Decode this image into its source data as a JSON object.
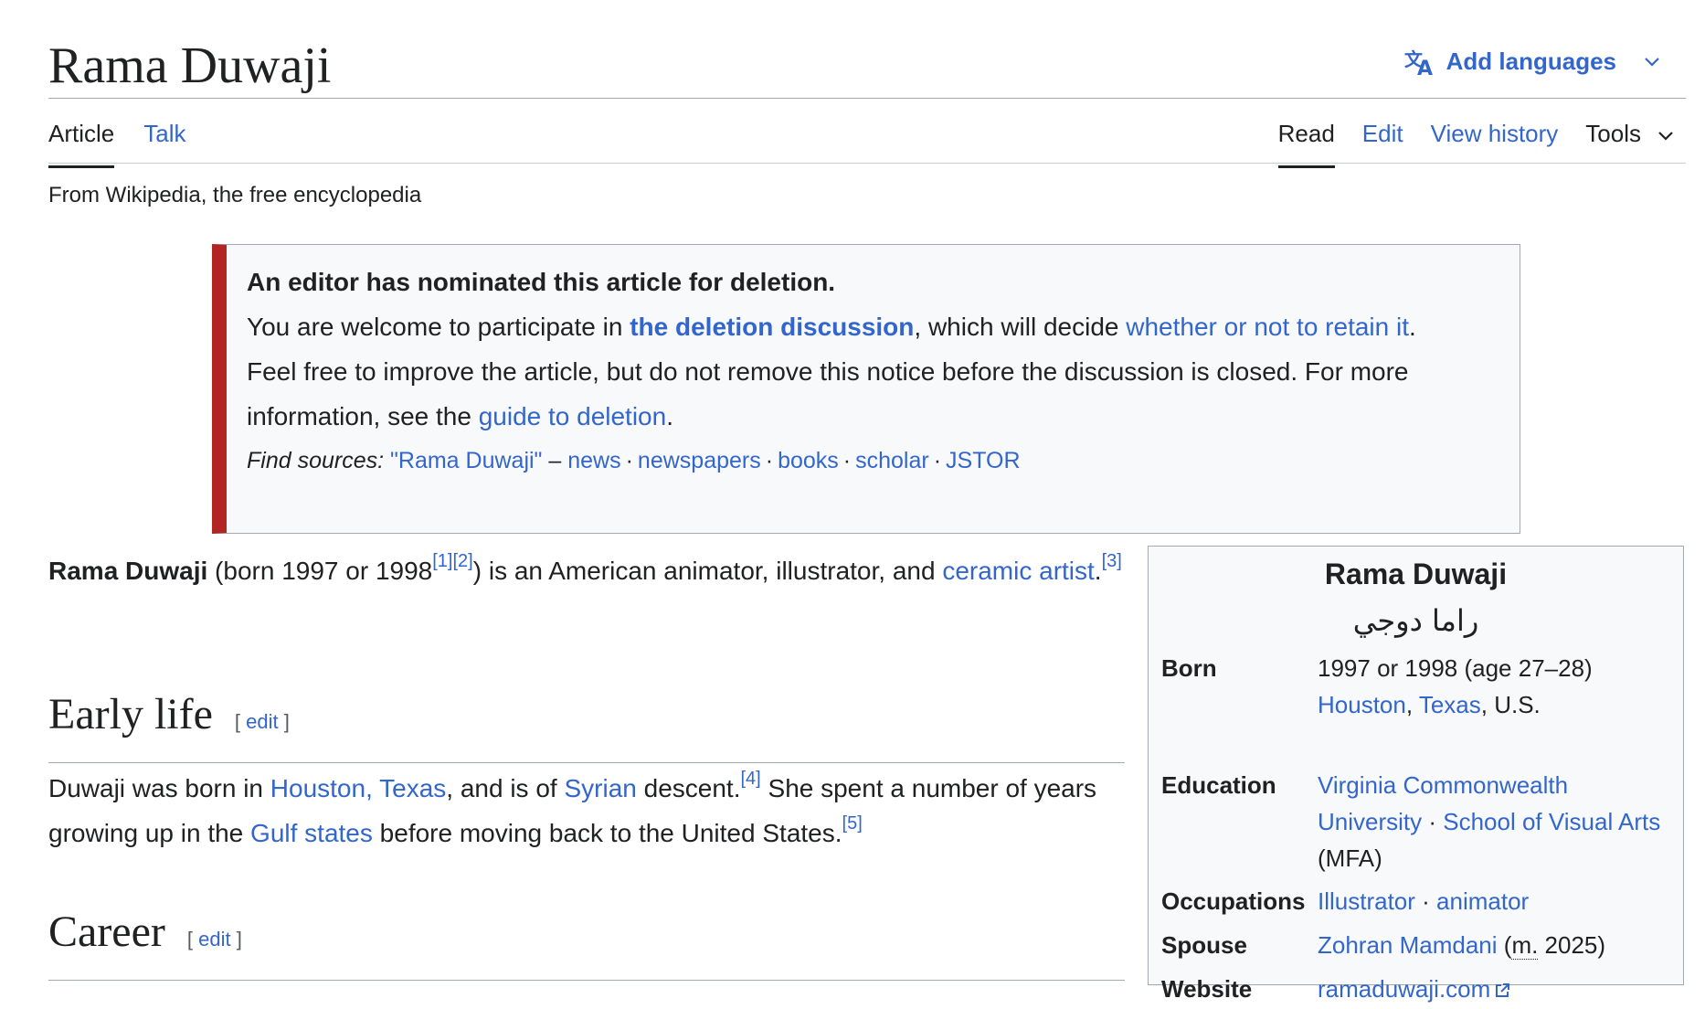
{
  "header": {
    "title": "Rama Duwaji",
    "add_languages": "Add languages"
  },
  "tabs_left": [
    "Article",
    "Talk"
  ],
  "tabs_right": {
    "read": "Read",
    "edit": "Edit",
    "history": "View history",
    "tools": "Tools"
  },
  "tagline": "From Wikipedia, the free encyclopedia",
  "afd_notice": {
    "heading": "An editor has nominated this article for deletion.",
    "line1_pre": "You are welcome to participate in ",
    "line1_link1": "the deletion discussion",
    "line1_mid": ", which will decide ",
    "line1_link2": "whether or not to retain it",
    "line1_post": ".",
    "line2_pre": "Feel free to improve the article, but do not remove this notice before the discussion is closed. For more information, see the ",
    "line2_link": "guide to deletion",
    "line2_post": ".",
    "find_sources_label": "Find sources:",
    "find_sources_query": "\"Rama Duwaji\"",
    "dash": " – ",
    "sources": [
      "news",
      "newspapers",
      "books",
      "scholar",
      "JSTOR"
    ],
    "separator": "·"
  },
  "lead": {
    "subject": "Rama Duwaji",
    "born_text": " (born 1997 or 1998",
    "ref1": "[1]",
    "ref2": "[2]",
    "mid": ") is an American animator, illustrator, and ",
    "link": "ceramic artist",
    "end": ".",
    "ref3": "[3]"
  },
  "early_life": {
    "heading": "Early life",
    "edit_open": "[ ",
    "edit": "edit",
    "edit_close": " ]",
    "p_1": "Duwaji was born in ",
    "link_houston": "Houston, Texas",
    "p_2": ", and is of ",
    "link_syrian": "Syrian",
    "p_3": " descent.",
    "ref4": "[4]",
    "p_4": " She spent a number of years growing up in the ",
    "link_gulf": "Gulf states",
    "p_5": " before moving back to the United States.",
    "ref5": "[5]"
  },
  "career": {
    "heading": "Career",
    "edit_open": "[ ",
    "edit": "edit",
    "edit_close": " ]"
  },
  "infobox": {
    "name": "Rama Duwaji",
    "native_name": "راما دوجي",
    "born_label": "Born",
    "born_line1": "1997 or 1998 (age 27–28)",
    "born_city": "Houston",
    "born_comma": ", ",
    "born_state": "Texas",
    "born_country": ", U.S.",
    "education_label": "Education",
    "education_link1": "Virginia Commonwealth University",
    "education_sep": " · ",
    "education_link2": "School of Visual Arts",
    "education_degree": "(MFA)",
    "occupations_label": "Occupations",
    "occupation1": "Illustrator",
    "occupation_sep": " · ",
    "occupation2": "animator",
    "spouse_label": "Spouse",
    "spouse_link": "Zohran Mamdani",
    "spouse_open": " (",
    "spouse_abbr": "m.",
    "spouse_year": " 2025)",
    "website_label": "Website",
    "website": "ramaduwaji.com"
  },
  "colors": {
    "link": "#3366cc",
    "text": "#202122",
    "afd_bar": "#b32424",
    "box_bg": "#f8f9fa",
    "border": "#a2a9b1"
  }
}
